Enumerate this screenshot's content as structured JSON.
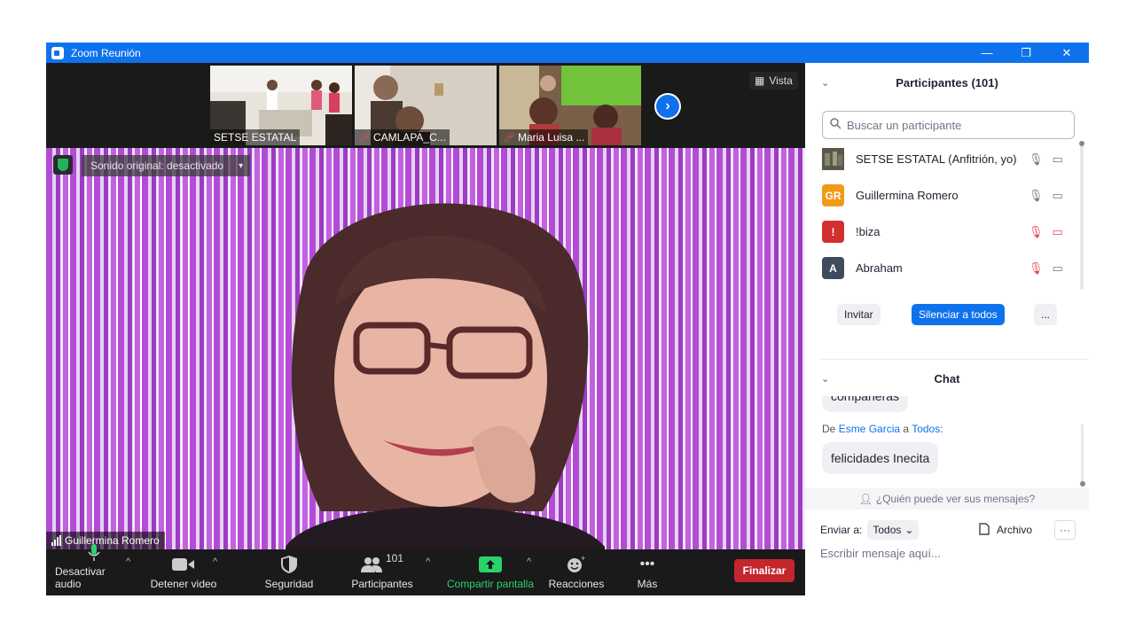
{
  "window": {
    "title": "Zoom Reunión",
    "min": "—",
    "max": "❐",
    "close": "✕"
  },
  "thumbnails": [
    {
      "name": "SETSE ESTATAL",
      "muted": false
    },
    {
      "name": "CAMLAPA_C...",
      "muted": true
    },
    {
      "name": "Maria Luisa ...",
      "muted": true
    }
  ],
  "view_label": "Vista",
  "video": {
    "audio_label": "Sonido original: desactivado",
    "speaker": "Guillermina Romero"
  },
  "toolbar": {
    "audio": "Desactivar audio",
    "video": "Detener video",
    "security": "Seguridad",
    "participants": "Participantes",
    "participants_count": "101",
    "share": "Compartir pantalla",
    "reactions": "Reacciones",
    "more": "Más",
    "end": "Finalizar"
  },
  "participants_panel": {
    "title": "Participantes (101)",
    "search_placeholder": "Buscar un participante",
    "items": [
      {
        "initials": "",
        "name": "SETSE ESTATAL (Anfitrión, yo)",
        "color": "#6b6a5a",
        "muted": false
      },
      {
        "initials": "GR",
        "name": "Guillermina Romero",
        "color": "#f09a1a",
        "muted": false
      },
      {
        "initials": "!",
        "name": "!biza",
        "color": "#d1302f",
        "muted": true
      },
      {
        "initials": "A",
        "name": "Abraham",
        "color": "#3d4b5c",
        "muted": true
      }
    ],
    "invite": "Invitar",
    "mute_all": "Silenciar a todos",
    "more": "..."
  },
  "chat": {
    "title": "Chat",
    "prev_message": "compañeras",
    "from_prefix": "De",
    "from_name": "Esme Garcia",
    "to_word": "a",
    "to_name": "Todos",
    "message": "felicidades Inecita",
    "privacy": "¿Quién puede ver sus mensajes?",
    "send_to_label": "Enviar a:",
    "send_to_value": "Todos",
    "file_label": "Archivo",
    "more": "···",
    "input_placeholder": "Escribir mensaje aquí..."
  }
}
